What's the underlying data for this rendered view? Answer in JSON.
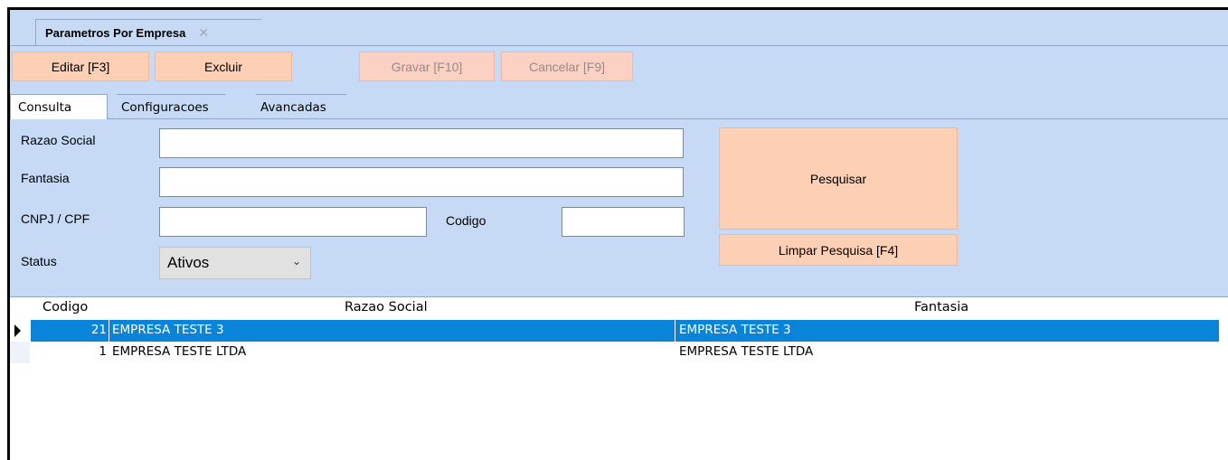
{
  "window": {
    "tab_title": "Parametros Por Empresa",
    "tab_close": "✕"
  },
  "toolbar": {
    "edit_label": "Editar [F3]",
    "delete_label": "Excluir",
    "save_label": "Gravar [F10]",
    "cancel_label": "Cancelar [F9]"
  },
  "tabs": {
    "consulta": "Consulta",
    "configuracoes": "Configuracoes",
    "avancadas": "Avancadas"
  },
  "form": {
    "razao_social_label": "Razao Social",
    "razao_social_value": "",
    "fantasia_label": "Fantasia",
    "fantasia_value": "",
    "cnpj_label": "CNPJ / CPF",
    "cnpj_value": "",
    "codigo_label": "Codigo",
    "codigo_value": "",
    "status_label": "Status",
    "status_value": "Ativos",
    "search_button": "Pesquisar",
    "clear_button": "Limpar Pesquisa [F4]"
  },
  "grid": {
    "columns": [
      "Codigo",
      "Razao Social",
      "Fantasia"
    ],
    "rows": [
      {
        "codigo": "21",
        "razao_social": "EMPRESA TESTE 3",
        "fantasia": "EMPRESA TESTE 3"
      },
      {
        "codigo": "1",
        "razao_social": "EMPRESA TESTE LTDA",
        "fantasia": "EMPRESA TESTE LTDA"
      }
    ]
  },
  "colors": {
    "panel_bg": "#c6daf6",
    "button_bg": "#fdd0b5",
    "selected_row": "#0a84d8"
  }
}
